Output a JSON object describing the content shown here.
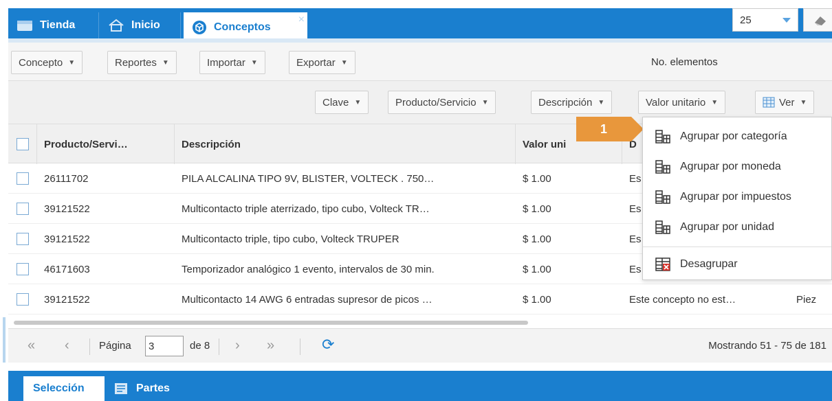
{
  "top_tabs": [
    {
      "label": "Tienda",
      "icon": "store-icon"
    },
    {
      "label": "Inicio",
      "icon": "home-icon"
    },
    {
      "label": "Conceptos",
      "icon": "box-icon"
    }
  ],
  "close_glyph": "×",
  "toolbar": {
    "concepto": "Concepto",
    "reportes": "Reportes",
    "importar": "Importar",
    "exportar": "Exportar",
    "no_elementos_label": "No. elementos",
    "page_size": "25"
  },
  "column_buttons": {
    "clave": "Clave",
    "producto": "Producto/Servicio",
    "descripcion": "Descripción",
    "valor": "Valor unitario",
    "ver": "Ver"
  },
  "table": {
    "headers": {
      "producto": "Producto/Servi…",
      "descripcion": "Descripción",
      "valor": "Valor uni",
      "extra": "D"
    },
    "rows": [
      {
        "producto": "26111702",
        "descripcion": "PILA ALCALINA TIPO 9V, BLISTER, VOLTECK . 750…",
        "valor": "$ 1.00",
        "extra": "Es",
        "unidad": ""
      },
      {
        "producto": "39121522",
        "descripcion": "Multicontacto triple aterrizado, tipo cubo, Volteck TR…",
        "valor": "$ 1.00",
        "extra": "Es",
        "unidad": ""
      },
      {
        "producto": "39121522",
        "descripcion": "Multicontacto triple, tipo cubo, Volteck TRUPER",
        "valor": "$ 1.00",
        "extra": "Es",
        "unidad": ""
      },
      {
        "producto": "46171603",
        "descripcion": "Temporizador analógico 1 evento, intervalos de 30 min.",
        "valor": "$ 1.00",
        "extra": "Es",
        "unidad": ""
      },
      {
        "producto": "39121522",
        "descripcion": "Multicontacto 14 AWG 6 entradas supresor de picos …",
        "valor": "$ 1.00",
        "extra": "Este concepto no est…",
        "unidad": "Piez"
      }
    ]
  },
  "pager": {
    "first": "«",
    "prev": "‹",
    "pagina_label": "Página",
    "current_page": "3",
    "de_label": "de 8",
    "next": "›",
    "last": "»",
    "refresh": "⟳",
    "status": "Mostrando 51 - 75 de 181"
  },
  "bottom_tabs": {
    "seleccion": "Selección",
    "partes": "Partes"
  },
  "menu": {
    "items": [
      {
        "label": "Agrupar por categoría",
        "icon": "group-icon"
      },
      {
        "label": "Agrupar por moneda",
        "icon": "group-icon"
      },
      {
        "label": "Agrupar por impuestos",
        "icon": "group-icon"
      },
      {
        "label": "Agrupar por unidad",
        "icon": "group-icon"
      },
      {
        "label": "Desagrupar",
        "icon": "ungroup-icon"
      }
    ]
  },
  "callout": "1",
  "colors": {
    "brand_blue": "#1a7fcf",
    "callout_orange": "#e8973c"
  }
}
